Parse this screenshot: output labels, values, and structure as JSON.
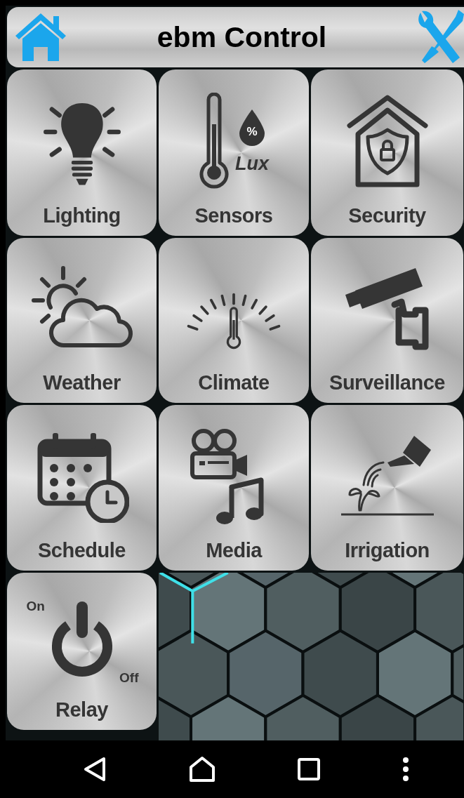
{
  "header": {
    "title": "ebm Control"
  },
  "tiles": [
    {
      "kind": "lighting",
      "label": "Lighting"
    },
    {
      "kind": "sensors",
      "label": "Sensors",
      "icon_texts": [
        "%",
        "Lux"
      ]
    },
    {
      "kind": "security",
      "label": "Security"
    },
    {
      "kind": "weather",
      "label": "Weather"
    },
    {
      "kind": "climate",
      "label": "Climate"
    },
    {
      "kind": "surveillance",
      "label": "Surveillance"
    },
    {
      "kind": "schedule",
      "label": "Schedule"
    },
    {
      "kind": "media",
      "label": "Media"
    },
    {
      "kind": "irrigation",
      "label": "Irrigation"
    },
    {
      "kind": "relay",
      "label": "Relay",
      "icon_texts": [
        "On",
        "Off"
      ]
    }
  ]
}
